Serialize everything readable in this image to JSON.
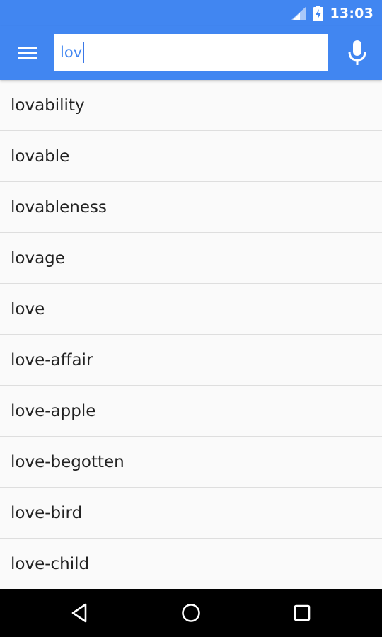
{
  "status_bar": {
    "time": "13:03",
    "background": "#4186f1",
    "icons": [
      "signal-icon",
      "battery-charging-icon"
    ]
  },
  "app_bar": {
    "background": "#4186f1",
    "menu_icon": "hamburger-menu-icon",
    "mic_icon": "microphone-icon"
  },
  "search": {
    "value": "lov",
    "text_color": "#4186f1"
  },
  "results": [
    "lovability",
    "lovable",
    "lovableness",
    "lovage",
    "love",
    "love-affair",
    "love-apple",
    "love-begotten",
    "love-bird",
    "love-child"
  ],
  "nav_bar": {
    "icons": [
      "back-icon",
      "home-icon",
      "recents-icon"
    ]
  }
}
